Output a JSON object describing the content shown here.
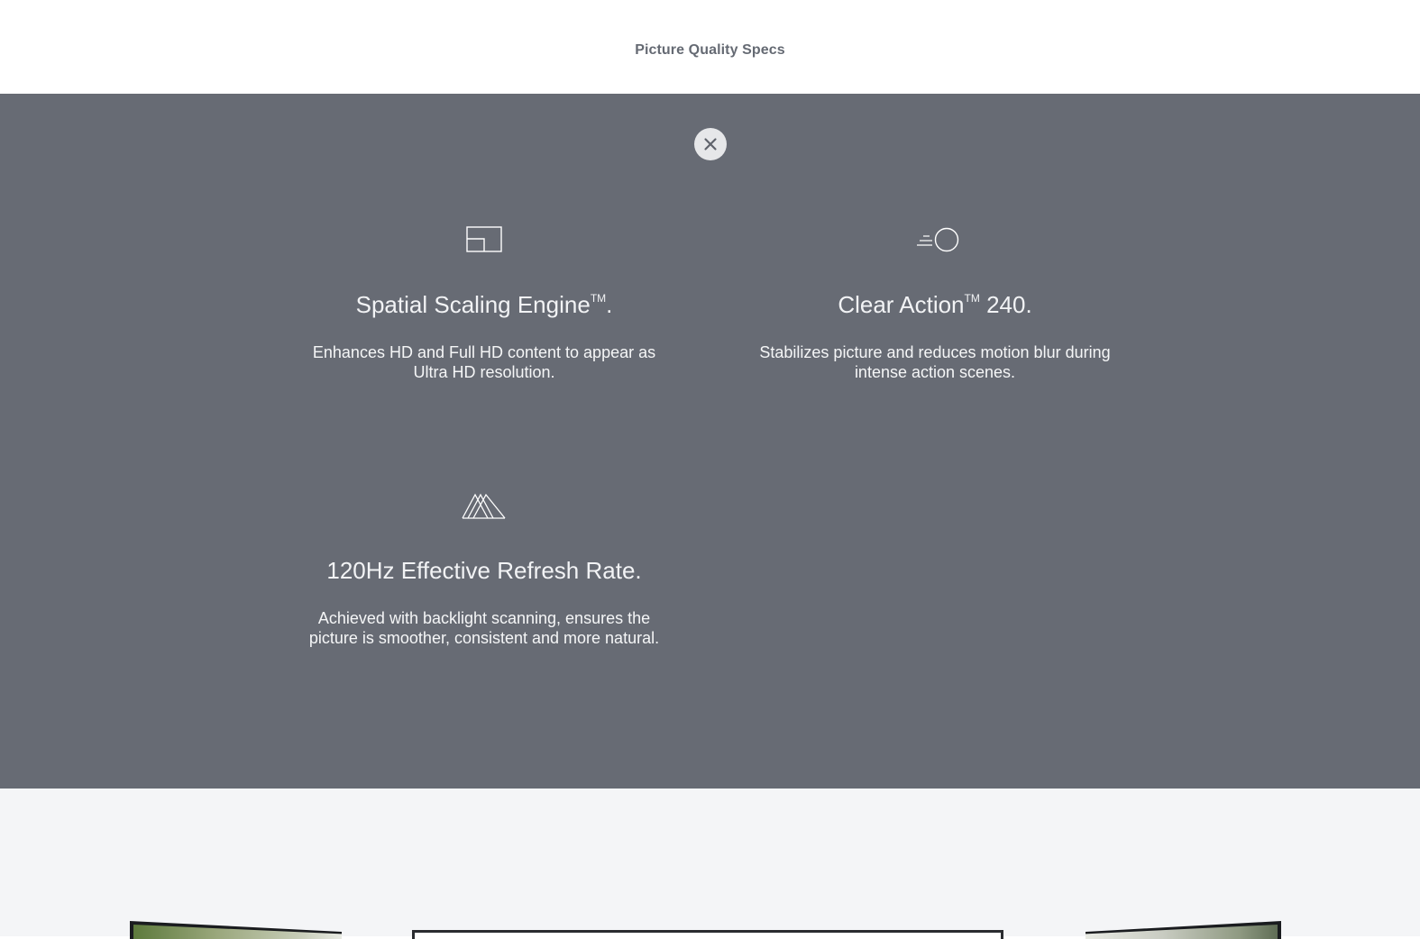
{
  "header": {
    "title": "Picture Quality Specs"
  },
  "specs_panel": {
    "close_icon": "close-icon",
    "features": [
      {
        "icon": "screen-scaling-icon",
        "title": "Spatial Scaling Engine",
        "title_sup": "TM",
        "title_suffix": ".",
        "description": "Enhances HD and Full HD content to appear as Ultra HD resolution."
      },
      {
        "icon": "motion-ball-icon",
        "title": "Clear Action",
        "title_sup": "TM",
        "title_suffix": " 240.",
        "description": "Stabilizes picture and reduces motion blur during intense action scenes."
      },
      {
        "icon": "mountains-icon",
        "title": "120Hz Effective Refresh Rate.",
        "description": "Achieved with backlight scanning, ensures the picture is smoother, consistent and more natural."
      }
    ]
  },
  "colors": {
    "panel_background": "#676b74",
    "header_text": "#656a73",
    "gallery_background": "#f4f5f7"
  }
}
